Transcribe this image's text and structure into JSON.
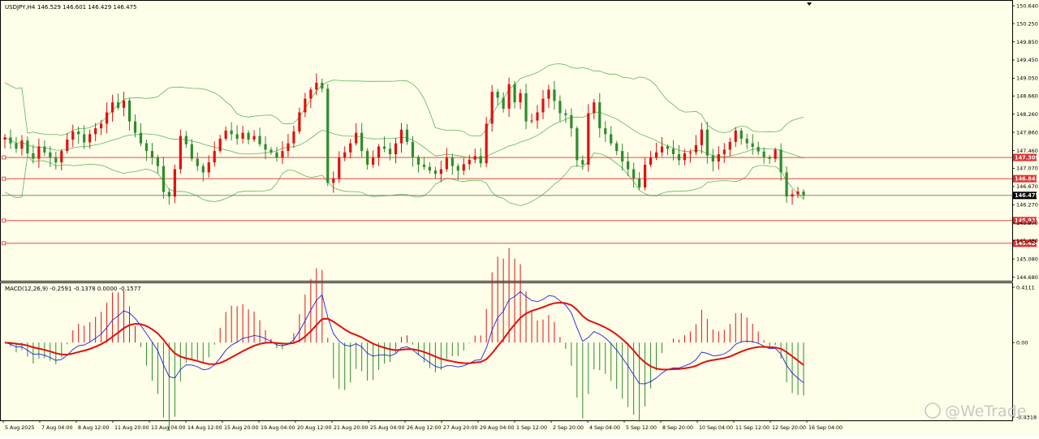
{
  "chart_data": {
    "type": "candlestick",
    "symbol_header": "USDJPY,H4",
    "ohlc_header": "146.529 146.601 146.429 146.475",
    "indicators": [
      "Bollinger Bands",
      "MACD"
    ],
    "price_axis": {
      "range": [
        144.6,
        150.75
      ],
      "ticks": [
        "150.640",
        "150.250",
        "149.850",
        "149.450",
        "149.050",
        "148.660",
        "148.260",
        "147.860",
        "147.460",
        "147.070",
        "146.670",
        "146.270",
        "145.870",
        "145.480",
        "145.080",
        "144.680"
      ]
    },
    "current_price": {
      "value": 146.475,
      "label": "146.475",
      "color": "#000000"
    },
    "price_levels": [
      {
        "value": 147.309,
        "label": "147.309",
        "color": "#e03030"
      },
      {
        "value": 146.843,
        "label": "146.843",
        "color": "#e03030"
      },
      {
        "value": 145.922,
        "label": "145.922",
        "color": "#e03030"
      },
      {
        "value": 145.424,
        "label": "145.424",
        "color": "#e03030"
      }
    ],
    "candles_close": [
      147.75,
      147.62,
      147.5,
      147.68,
      147.4,
      147.28,
      147.55,
      147.42,
      147.3,
      147.2,
      147.45,
      147.7,
      147.88,
      147.82,
      147.64,
      147.82,
      147.95,
      148.05,
      148.3,
      148.52,
      148.4,
      148.56,
      148.1,
      147.85,
      147.62,
      147.45,
      147.3,
      147.12,
      146.55,
      146.45,
      147.05,
      147.78,
      147.6,
      147.28,
      147.12,
      146.98,
      147.2,
      147.45,
      147.72,
      147.9,
      147.82,
      147.72,
      147.85,
      147.7,
      147.78,
      147.6,
      147.48,
      147.42,
      147.3,
      147.45,
      147.62,
      147.88,
      148.3,
      148.6,
      148.8,
      148.95,
      148.82,
      146.75,
      146.85,
      147.3,
      147.42,
      147.62,
      147.85,
      147.45,
      147.15,
      147.3,
      147.55,
      147.5,
      147.38,
      147.62,
      147.92,
      147.65,
      147.32,
      147.15,
      147.1,
      147.02,
      146.95,
      147.05,
      147.3,
      147.12,
      147.02,
      147.16,
      147.26,
      147.34,
      147.18,
      148.05,
      148.75,
      148.62,
      148.38,
      148.92,
      148.52,
      148.72,
      148.1,
      148.12,
      148.3,
      148.6,
      148.8,
      148.55,
      148.28,
      148.24,
      147.95,
      147.25,
      147.15,
      148.28,
      148.52,
      147.95,
      147.82,
      147.62,
      147.45,
      147.22,
      147.05,
      146.85,
      146.65,
      147.15,
      147.3,
      147.42,
      147.55,
      147.5,
      147.38,
      147.25,
      147.4,
      147.42,
      147.58,
      147.92,
      147.35,
      147.22,
      147.38,
      147.48,
      147.65,
      147.9,
      147.72,
      147.62,
      147.54,
      147.44,
      147.32,
      147.28,
      147.48,
      146.98,
      146.45,
      146.5,
      146.56,
      146.475
    ],
    "macd_header": "MACD(12,26,9) -0.2591 -0.1378 0.0000 -0.1577",
    "macd_axis": {
      "range": [
        -0.55,
        0.42
      ],
      "ticks": [
        "0.4111",
        "0.00",
        "-0.4318"
      ]
    },
    "macd_series": [
      {
        "name": "MACD",
        "color": "#d4d4a0"
      },
      {
        "name": "Signal",
        "color": "#e01010"
      },
      {
        "name": "OsMA",
        "color": "#2020e0"
      }
    ],
    "time_axis": [
      "5 Aug 2025",
      "7 Aug 04:00",
      "8 Aug 12:00",
      "11 Aug 20:00",
      "13 Aug 04:00",
      "14 Aug 12:00",
      "15 Aug 20:00",
      "19 Aug 04:00",
      "20 Aug 12:00",
      "21 Aug 20:00",
      "25 Aug 04:00",
      "26 Aug 12:00",
      "27 Aug 20:00",
      "29 Aug 04:00",
      "1 Sep 12:00",
      "2 Sep 20:00",
      "4 Sep 04:00",
      "5 Sep 12:00",
      "8 Sep 20:00",
      "10 Sep 04:00",
      "11 Sep 12:00",
      "12 Sep 20:00",
      "16 Sep 04:00"
    ],
    "colors": {
      "bull": "#e01010",
      "bear": "#2e8b2e",
      "bands": "#5cb85c",
      "background": "#fefee9"
    }
  },
  "watermark": "@WeTrade"
}
